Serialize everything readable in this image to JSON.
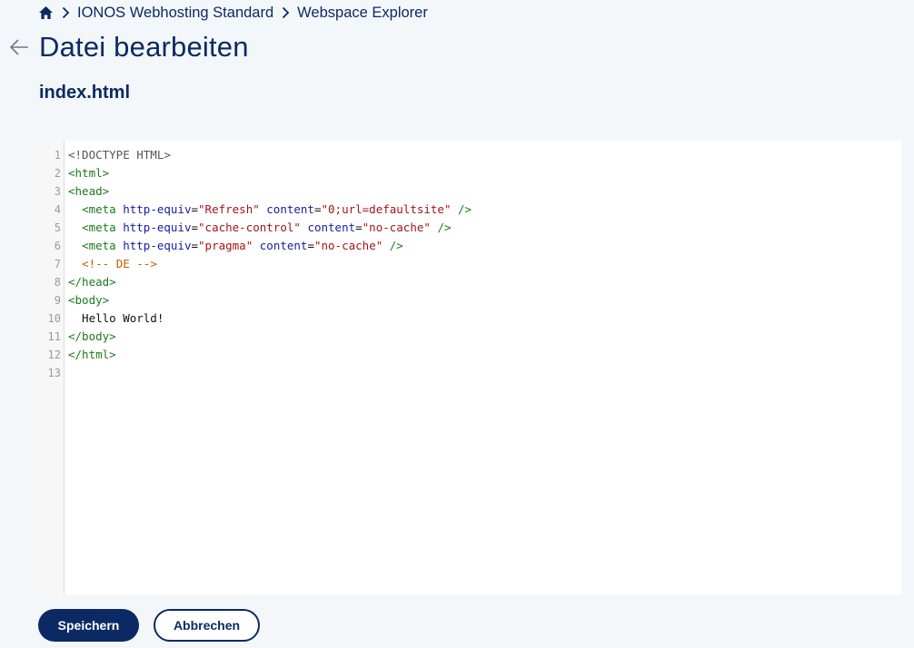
{
  "breadcrumb": {
    "items": [
      "IONOS Webhosting Standard",
      "Webspace Explorer"
    ]
  },
  "page": {
    "title": "Datei bearbeiten",
    "filename": "index.html"
  },
  "editor": {
    "line_numbers": [
      "1",
      "2",
      "3",
      "4",
      "5",
      "6",
      "7",
      "8",
      "9",
      "10",
      "11",
      "12",
      "13"
    ],
    "lines": [
      [
        {
          "t": "doctype",
          "v": "<!DOCTYPE HTML>"
        }
      ],
      [
        {
          "t": "tag",
          "v": "<html>"
        }
      ],
      [
        {
          "t": "tag",
          "v": "<head>"
        }
      ],
      [
        {
          "t": "text",
          "v": "  "
        },
        {
          "t": "tag",
          "v": "<meta "
        },
        {
          "t": "attr",
          "v": "http-equiv"
        },
        {
          "t": "text",
          "v": "="
        },
        {
          "t": "str",
          "v": "\"Refresh\""
        },
        {
          "t": "text",
          "v": " "
        },
        {
          "t": "attr",
          "v": "content"
        },
        {
          "t": "text",
          "v": "="
        },
        {
          "t": "str",
          "v": "\"0;url=defaultsite\""
        },
        {
          "t": "text",
          "v": " "
        },
        {
          "t": "tag",
          "v": "/>"
        }
      ],
      [
        {
          "t": "text",
          "v": "  "
        },
        {
          "t": "tag",
          "v": "<meta "
        },
        {
          "t": "attr",
          "v": "http-equiv"
        },
        {
          "t": "text",
          "v": "="
        },
        {
          "t": "str",
          "v": "\"cache-control\""
        },
        {
          "t": "text",
          "v": " "
        },
        {
          "t": "attr",
          "v": "content"
        },
        {
          "t": "text",
          "v": "="
        },
        {
          "t": "str",
          "v": "\"no-cache\""
        },
        {
          "t": "text",
          "v": " "
        },
        {
          "t": "tag",
          "v": "/>"
        }
      ],
      [
        {
          "t": "text",
          "v": "  "
        },
        {
          "t": "tag",
          "v": "<meta "
        },
        {
          "t": "attr",
          "v": "http-equiv"
        },
        {
          "t": "text",
          "v": "="
        },
        {
          "t": "str",
          "v": "\"pragma\""
        },
        {
          "t": "text",
          "v": " "
        },
        {
          "t": "attr",
          "v": "content"
        },
        {
          "t": "text",
          "v": "="
        },
        {
          "t": "str",
          "v": "\"no-cache\""
        },
        {
          "t": "text",
          "v": " "
        },
        {
          "t": "tag",
          "v": "/>"
        }
      ],
      [
        {
          "t": "text",
          "v": "  "
        },
        {
          "t": "comment",
          "v": "<!-- DE -->"
        }
      ],
      [
        {
          "t": "tag",
          "v": "</head>"
        }
      ],
      [
        {
          "t": "tag",
          "v": "<body>"
        }
      ],
      [
        {
          "t": "text",
          "v": "  Hello World!"
        }
      ],
      [
        {
          "t": "tag",
          "v": "</body>"
        }
      ],
      [
        {
          "t": "tag",
          "v": "</html>"
        }
      ],
      []
    ]
  },
  "actions": {
    "save_label": "Speichern",
    "cancel_label": "Abbrechen"
  },
  "colors": {
    "brand": "#0b2a63",
    "background": "#f4f7fa"
  },
  "icons": {
    "home": "home-icon",
    "separator": "chevron-right-icon",
    "back": "arrow-left-icon"
  }
}
